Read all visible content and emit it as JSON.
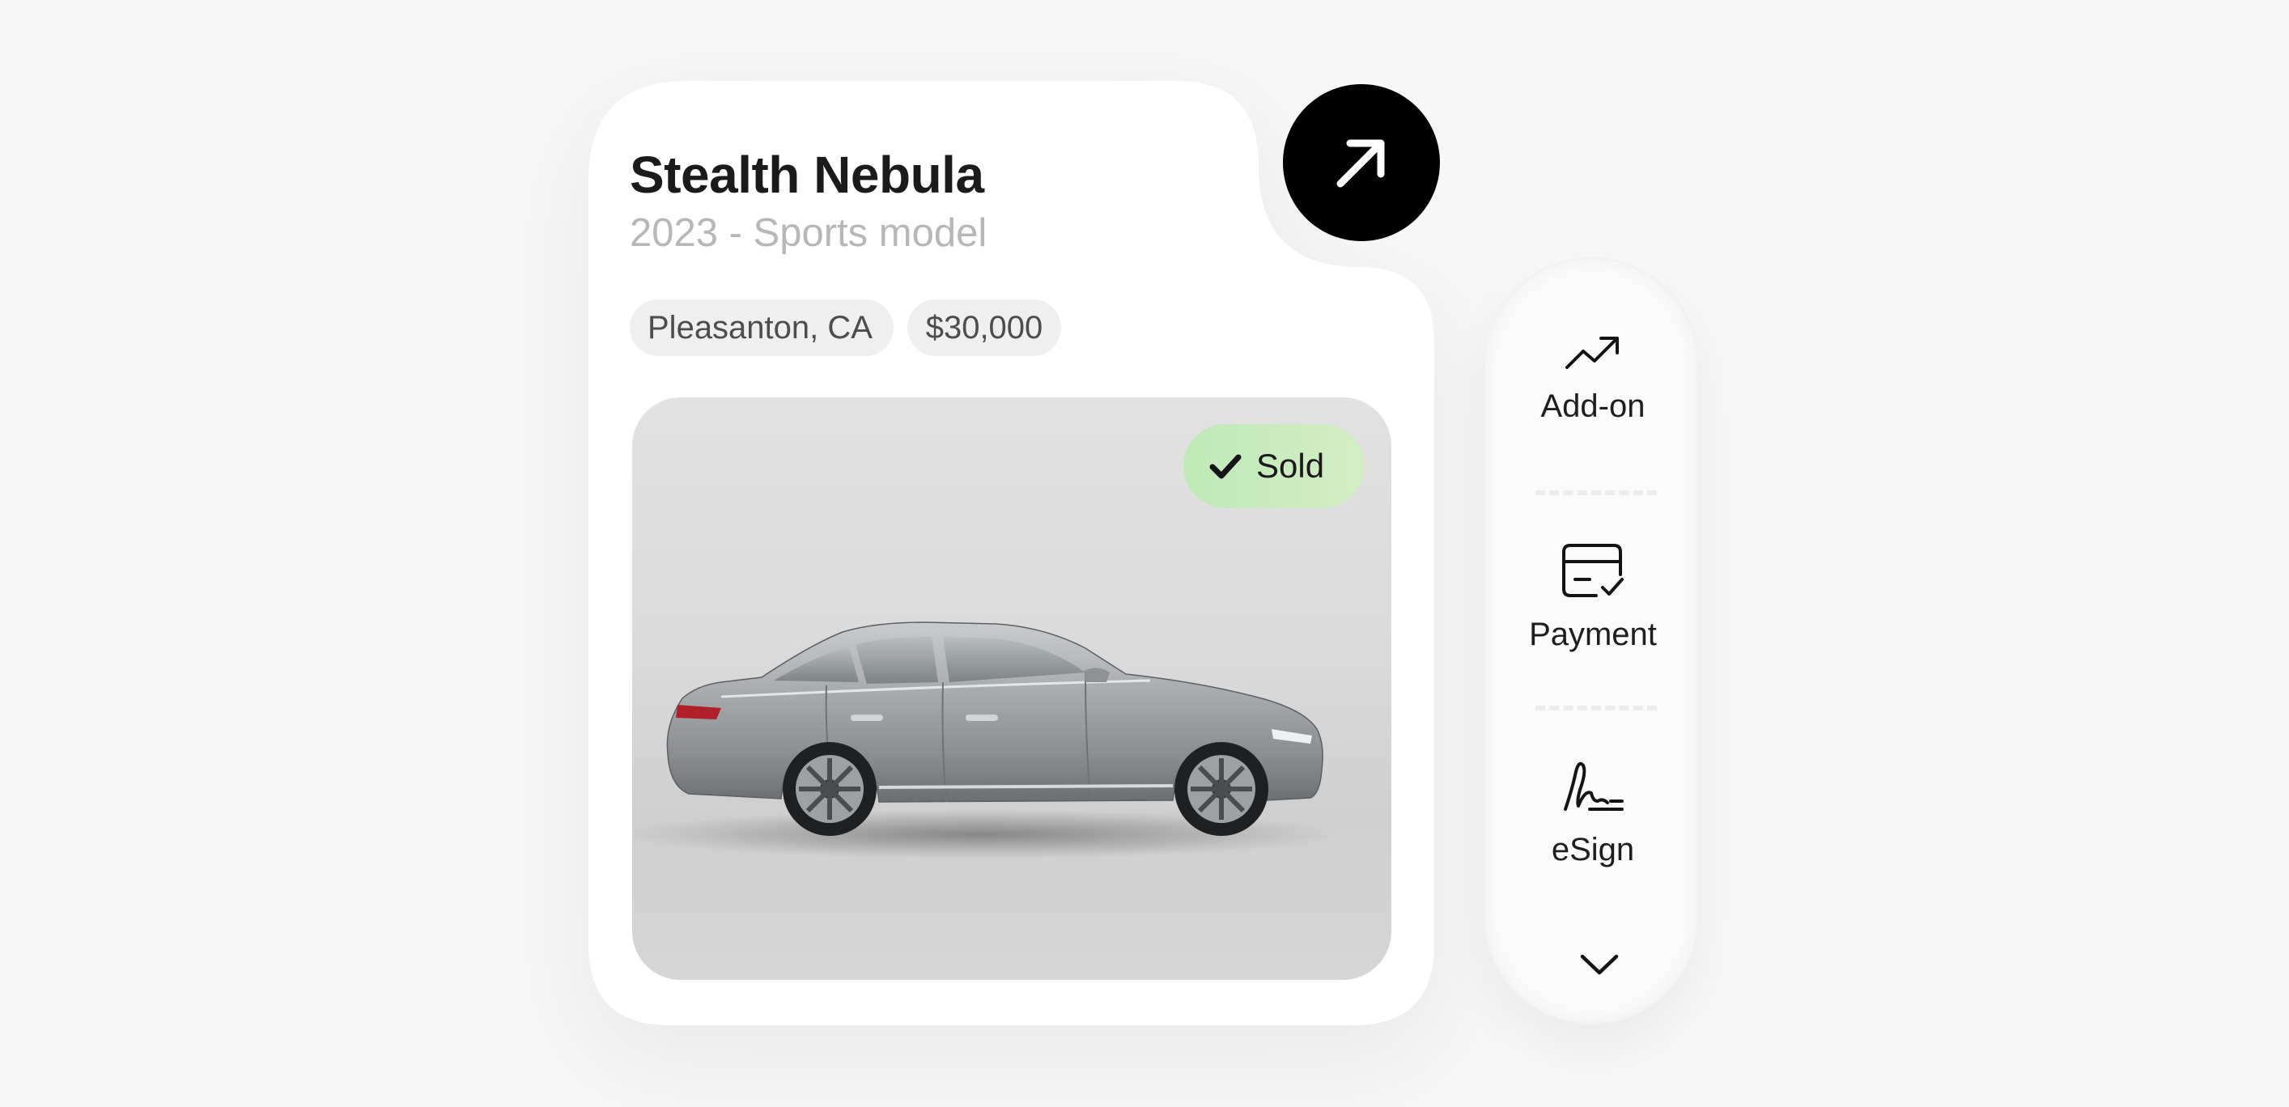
{
  "listing": {
    "title": "Stealth Nebula",
    "subtitle": "2023 - Sports model",
    "location": "Pleasanton, CA",
    "price": "$30,000",
    "status": "Sold",
    "status_color": "#c5ebbd"
  },
  "open_button": {
    "icon": "arrow-up-right-icon"
  },
  "side_menu": {
    "items": [
      {
        "label": "Add-on",
        "icon": "trending-up-icon"
      },
      {
        "label": "Payment",
        "icon": "card-check-icon"
      },
      {
        "label": "eSign",
        "icon": "signature-icon"
      }
    ],
    "expand_icon": "chevron-down-icon"
  },
  "colors": {
    "background": "#f8f7f7",
    "card": "#ffffff",
    "accent": "#000000",
    "muted_text": "#b7b7b7"
  }
}
